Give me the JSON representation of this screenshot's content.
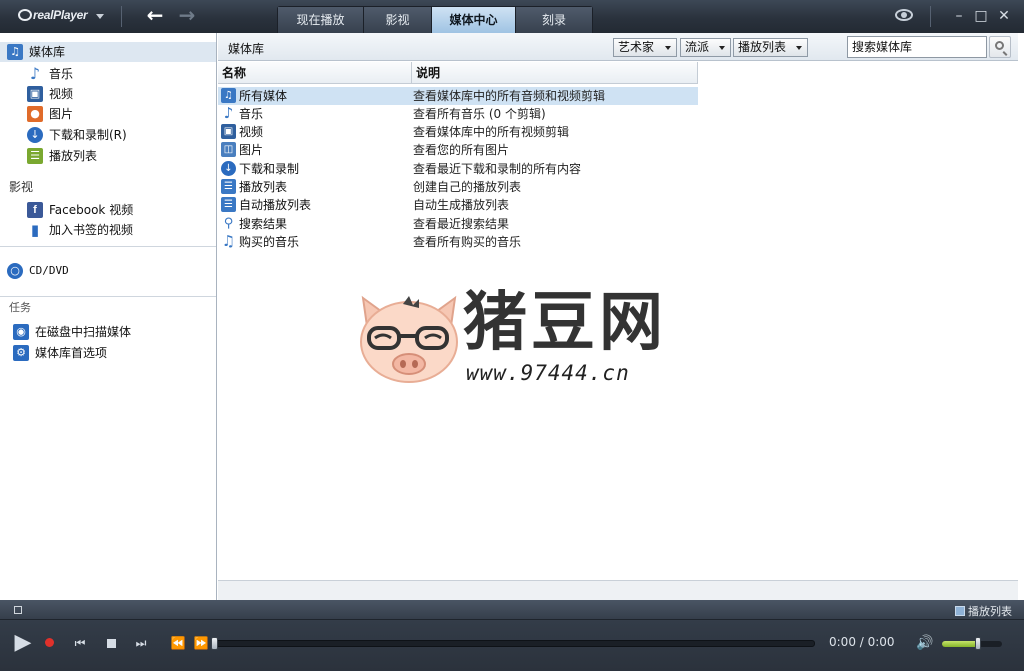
{
  "app": {
    "logo_text": "realPlayer"
  },
  "nav_tabs": [
    {
      "label": "现在播放"
    },
    {
      "label": "影视"
    },
    {
      "label": "媒体中心"
    },
    {
      "label": "刻录"
    }
  ],
  "active_tab": "媒体中心",
  "sidebar": {
    "header_item": {
      "label": "媒体库",
      "icon": "library-icon",
      "color": "#3a78c4"
    },
    "library_items": [
      {
        "label": "音乐",
        "icon": "music-note-icon",
        "color": "#3a78c4"
      },
      {
        "label": "视频",
        "icon": "video-icon",
        "color": "#2f5f9e"
      },
      {
        "label": "图片",
        "icon": "picture-icon",
        "color": "#e06b2a"
      },
      {
        "label": "下载和录制(R)",
        "icon": "download-icon",
        "color": "#2b6bbf"
      },
      {
        "label": "播放列表",
        "icon": "playlist-icon",
        "color": "#7aa830"
      }
    ],
    "section_video": "影视",
    "video_items": [
      {
        "label": "Facebook 视频",
        "icon": "facebook-icon",
        "color": "#3b5998"
      },
      {
        "label": "加入书签的视频",
        "icon": "bookmark-icon",
        "color": "#2b6bbf"
      }
    ],
    "cd_item": {
      "label": "CD/DVD",
      "icon": "disc-icon",
      "color": "#2b6bbf"
    },
    "section_tasks": "任务",
    "task_items": [
      {
        "label": "在磁盘中扫描媒体",
        "icon": "scan-icon",
        "color": "#2b6bbf"
      },
      {
        "label": "媒体库首选项",
        "icon": "preferences-icon",
        "color": "#2b6bbf"
      }
    ]
  },
  "main": {
    "title": "媒体库",
    "filters": [
      {
        "label": "艺术家"
      },
      {
        "label": "流派"
      },
      {
        "label": "播放列表"
      }
    ],
    "search_placeholder": "搜索媒体库",
    "columns": {
      "name": "名称",
      "description": "说明"
    },
    "rows": [
      {
        "name": "所有媒体",
        "description": "查看媒体库中的所有音频和视频剪辑",
        "icon": "all-media-icon",
        "color": "#3a78c4",
        "selected": true
      },
      {
        "name": "音乐",
        "description": "查看所有音乐 (0 个剪辑)",
        "icon": "music-note-icon",
        "color": "#3a78c4"
      },
      {
        "name": "视频",
        "description": "查看媒体库中的所有视频剪辑",
        "icon": "video-icon",
        "color": "#2f5f9e"
      },
      {
        "name": "图片",
        "description": "查看您的所有图片",
        "icon": "picture-icon",
        "color": "#4a7fbf"
      },
      {
        "name": "下载和录制",
        "description": "查看最近下载和录制的所有内容",
        "icon": "download-icon",
        "color": "#2b6bbf"
      },
      {
        "name": "播放列表",
        "description": "创建自己的播放列表",
        "icon": "playlist-icon",
        "color": "#3a78c4"
      },
      {
        "name": "自动播放列表",
        "description": "自动生成播放列表",
        "icon": "auto-playlist-icon",
        "color": "#3a78c4"
      },
      {
        "name": "搜索结果",
        "description": "查看最近搜索结果",
        "icon": "search-icon",
        "color": "#3a78c4"
      },
      {
        "name": "购买的音乐",
        "description": "查看所有购买的音乐",
        "icon": "purchased-music-icon",
        "color": "#3a78c4"
      }
    ]
  },
  "watermark": {
    "brand": "猪豆网",
    "url": "www.97444.cn"
  },
  "player": {
    "playlist_label": "播放列表",
    "time": "0:00 / 0:00",
    "seek_position": 0,
    "volume_level": 0.6
  }
}
